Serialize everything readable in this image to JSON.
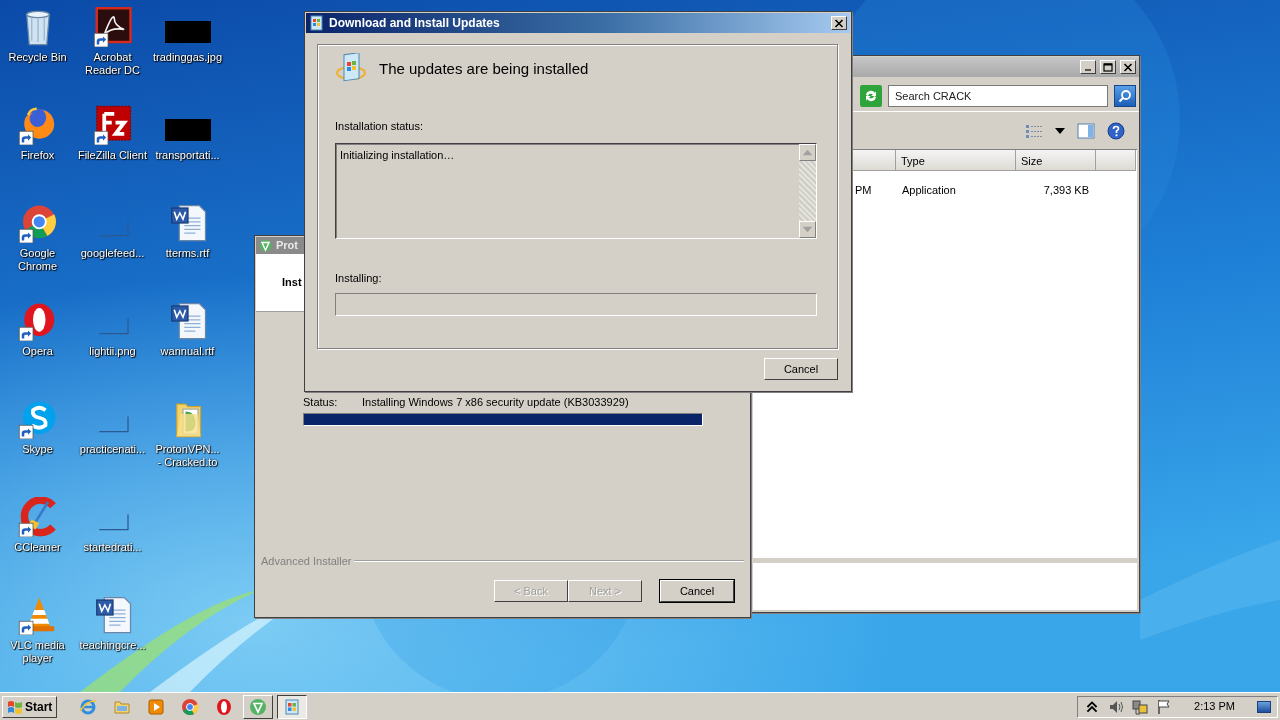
{
  "desktop_icons": [
    {
      "label": "Recycle Bin",
      "kind": "bin",
      "shortcut": false
    },
    {
      "label": "Firefox",
      "kind": "firefox",
      "shortcut": true
    },
    {
      "label": "Google Chrome",
      "kind": "chrome",
      "shortcut": true
    },
    {
      "label": "Opera",
      "kind": "opera",
      "shortcut": true
    },
    {
      "label": "Skype",
      "kind": "skype",
      "shortcut": true
    },
    {
      "label": "CCleaner",
      "kind": "ccleaner",
      "shortcut": true
    },
    {
      "label": "VLC media player",
      "kind": "vlc",
      "shortcut": true
    },
    {
      "label": "Acrobat Reader DC",
      "kind": "acrobat",
      "shortcut": true
    },
    {
      "label": "FileZilla Client",
      "kind": "filezilla",
      "shortcut": true
    },
    {
      "label": "googlefeed...",
      "kind": "blank",
      "shortcut": false
    },
    {
      "label": "lightii.png",
      "kind": "blank",
      "shortcut": false
    },
    {
      "label": "practicenati...",
      "kind": "blank",
      "shortcut": false
    },
    {
      "label": "startedrati...",
      "kind": "blank",
      "shortcut": false
    },
    {
      "label": "teachingcre...",
      "kind": "word",
      "shortcut": false
    },
    {
      "label": "tradinggas.jpg",
      "kind": "redacted",
      "shortcut": false
    },
    {
      "label": "transportati...",
      "kind": "redacted",
      "shortcut": false
    },
    {
      "label": "tterms.rtf",
      "kind": "word",
      "shortcut": false
    },
    {
      "label": "wannual.rtf",
      "kind": "word",
      "shortcut": false
    },
    {
      "label": "ProtonVPN... - Cracked.to",
      "kind": "folder",
      "shortcut": false
    }
  ],
  "explorer": {
    "search": {
      "placeholder": "Search CRACK"
    },
    "columns": [
      "Type",
      "Size"
    ],
    "rows": [
      {
        "modified": "PM",
        "type": "Application",
        "size": "7,393 KB"
      }
    ]
  },
  "installer": {
    "title": "Prot",
    "heading": "Inst",
    "status_label": "Status:",
    "status": "Installing Windows 7 x86 security update (KB3033929)",
    "level": 1,
    "brand": "Advanced Installer",
    "buttons": [
      {
        "label": "< Back",
        "disabled": true,
        "default": false
      },
      {
        "label": "Next >",
        "disabled": true,
        "default": false
      },
      {
        "label": "Cancel",
        "disabled": false,
        "default": true
      }
    ]
  },
  "update_dialog": {
    "title": "Download and Install Updates",
    "heading": "The updates are being installed",
    "status_label": "Installation status:",
    "log": "Initializing installation…",
    "installing_label": "Installing:",
    "level": 0,
    "cancel": "Cancel"
  },
  "taskbar": {
    "start": "Start",
    "items": [
      {
        "kind": "ie",
        "running": false,
        "selected": false
      },
      {
        "kind": "explorer",
        "running": false,
        "selected": false
      },
      {
        "kind": "media",
        "running": false,
        "selected": false
      },
      {
        "kind": "chrome",
        "running": false,
        "selected": false
      },
      {
        "kind": "opera",
        "running": false,
        "selected": false
      },
      {
        "kind": "proton",
        "running": true,
        "selected": false
      },
      {
        "kind": "update",
        "running": true,
        "selected": true
      }
    ],
    "clock": "2:13 PM"
  }
}
